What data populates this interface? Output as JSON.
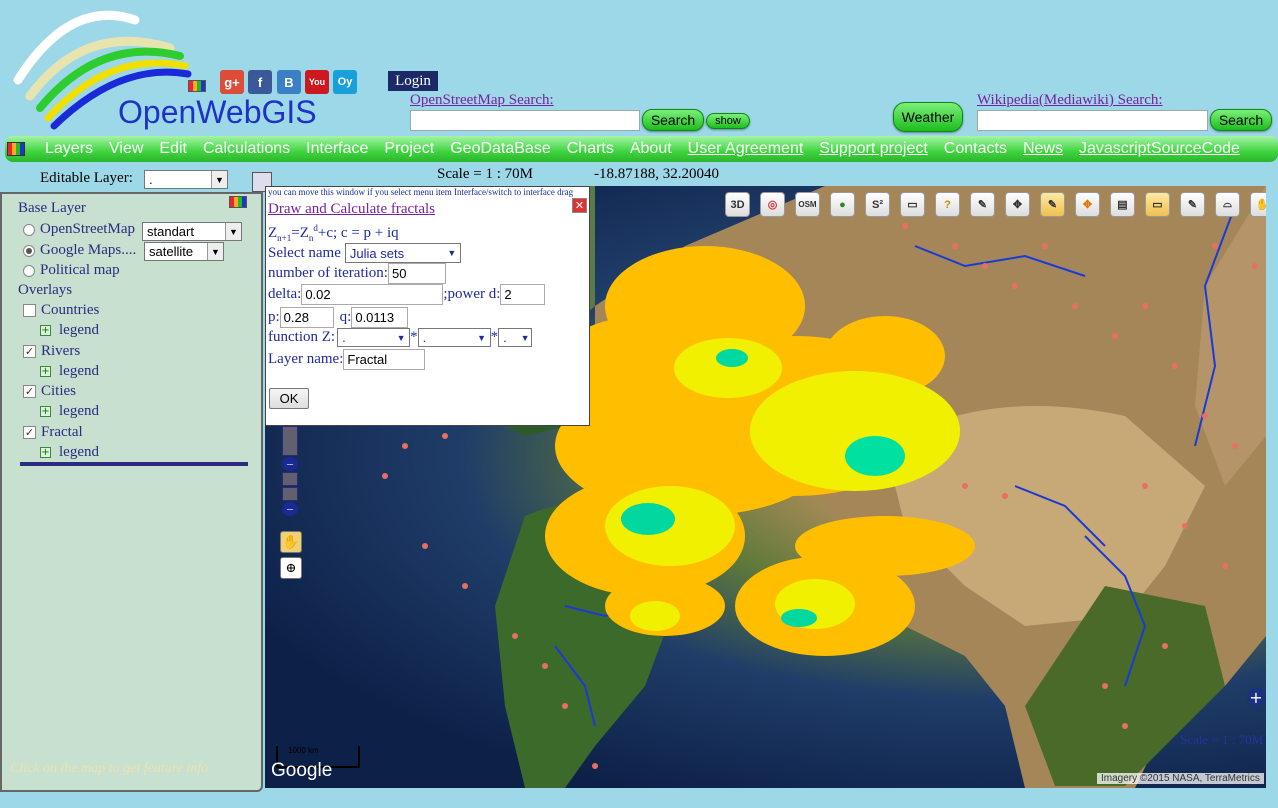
{
  "header": {
    "site_title": "OpenWebGIS",
    "login_label": "Login",
    "social_icons": [
      "google-plus-icon",
      "facebook-icon",
      "blogger-icon",
      "youtube-icon",
      "oy-icon"
    ],
    "social_glyphs": [
      "g+",
      "f",
      "B",
      "You",
      "Oy"
    ],
    "osm_search_label": "OpenStreetMap  Search:",
    "osm_search_value": "",
    "search_button": "Search",
    "show_button": "show",
    "weather_button": "Weather",
    "wiki_search_label": "Wikipedia(Mediawiki)  Search:",
    "wiki_search_value": "",
    "wiki_search_button": "Search"
  },
  "menu": {
    "items": [
      "Layers",
      "View",
      "Edit",
      "Calculations",
      "Interface",
      "Project",
      "GeoDataBase",
      "Charts",
      "About"
    ],
    "links": [
      "User Agreement",
      "Support project",
      "Contacts",
      "News",
      "JavascriptSourceCode"
    ],
    "contacts": "Contacts"
  },
  "status": {
    "editable_layer_label": "Editable Layer:",
    "editable_layer_value": ".",
    "scale": "Scale = 1 : 70M",
    "coordinates": "-18.87188, 32.20040"
  },
  "layers_panel": {
    "base_layer_title": "Base Layer",
    "base_layers": [
      {
        "label": "OpenStreetMap",
        "selected": false,
        "select_value": "standart"
      },
      {
        "label": "Google Maps....",
        "selected": true,
        "select_value": "satellite"
      },
      {
        "label": "Political map",
        "selected": false
      }
    ],
    "overlays_title": "Overlays",
    "overlays": [
      {
        "label": "Countries",
        "checked": false,
        "legend": "legend"
      },
      {
        "label": "Rivers",
        "checked": true,
        "legend": "legend"
      },
      {
        "label": "Cities",
        "checked": true,
        "legend": "legend"
      },
      {
        "label": "Fractal",
        "checked": true,
        "legend": "legend"
      }
    ],
    "hint": "Click on the map to get feature info"
  },
  "dialog": {
    "hint": "you can move this window if you select menu item Interface/switch to interface drag",
    "title": "Draw and Calculate fractals",
    "select_name_label": "Select name",
    "select_name_value": "Julia sets",
    "iterations_label": "number of iteration:",
    "iterations_value": "50",
    "delta_label": "delta:",
    "delta_value": "0.02",
    "power_label": ";power d:",
    "power_value": "2",
    "p_label": "p:",
    "p_value": "0.28",
    "q_label": "q:",
    "q_value": "0.0113",
    "function_label": "function Z:",
    "function_values": [
      ".",
      ".",
      "."
    ],
    "layer_name_label": "Layer name:",
    "layer_name_value": "Fractal",
    "ok_button": "OK"
  },
  "map": {
    "toolbar_icons": [
      "3d-icon",
      "target-icon",
      "osm-icon",
      "globe-icon",
      "s2-icon",
      "ruler-icon",
      "info-pencil-icon",
      "pencil-icon",
      "move-icon",
      "edit-icon",
      "drag-icon",
      "save-icon",
      "rectangle-icon",
      "draw-polygon-icon",
      "polygon-icon",
      "hand-icon"
    ],
    "toolbar_glyphs": [
      "3D",
      "◎",
      "OSM",
      "●",
      "S²",
      "▭",
      "?",
      "✎",
      "✥",
      "✎",
      "✥",
      "▤",
      "▭",
      "✎",
      "⌓",
      "✋"
    ],
    "google_logo": "Google",
    "attribution": "Imagery ©2015 NASA, TerraMetrics",
    "scale_label": "Scale = 1 : 70M",
    "scalebar_label": "1000 km"
  }
}
